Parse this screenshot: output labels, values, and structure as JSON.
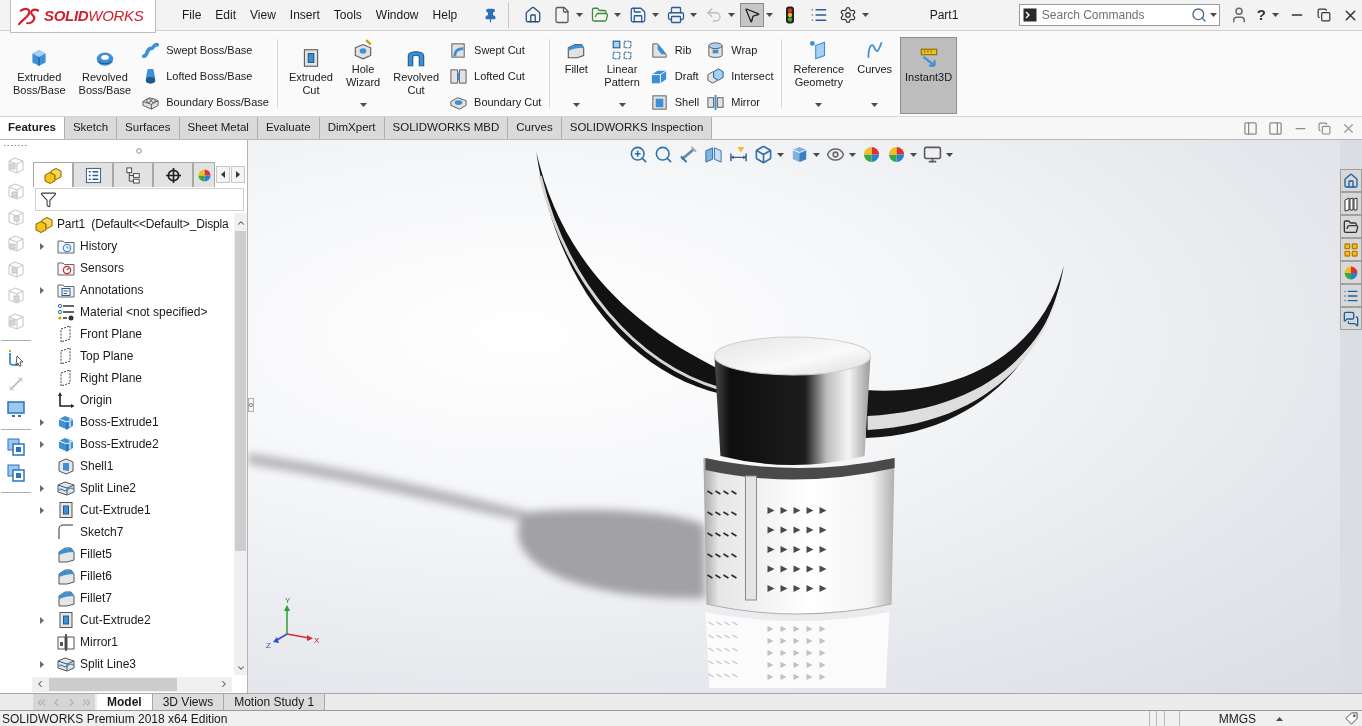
{
  "app": {
    "logo": "**SOLID**WORKS"
  },
  "menu": [
    "File",
    "Edit",
    "View",
    "Insert",
    "Tools",
    "Window",
    "Help"
  ],
  "quick_access": [
    {
      "dropdown": false,
      "pressed": false,
      "disabled": false
    },
    {
      "dropdown": true,
      "pressed": false,
      "disabled": false
    },
    {
      "dropdown": true,
      "pressed": false,
      "disabled": false
    },
    {
      "dropdown": true,
      "pressed": false,
      "disabled": false
    },
    {
      "dropdown": true,
      "pressed": false,
      "disabled": false
    },
    {
      "dropdown": true,
      "pressed": false,
      "disabled": true
    },
    {
      "dropdown": true,
      "pressed": true,
      "disabled": false
    },
    {
      "dropdown": false,
      "pressed": false,
      "disabled": false
    },
    {
      "dropdown": false,
      "pressed": false,
      "disabled": false
    },
    {
      "dropdown": true,
      "pressed": false,
      "disabled": false
    }
  ],
  "document_title": "Part1",
  "search": {
    "placeholder": "Search Commands"
  },
  "help": "?",
  "ribbon": {
    "groups": [
      {
        "items": [
          {
            "kind": "large",
            "label": "Extruded Boss/Base",
            "dropdown": false,
            "pressed": false
          },
          {
            "kind": "large",
            "label": "Revolved Boss/Base",
            "dropdown": false,
            "pressed": false
          },
          {
            "kind": "stack",
            "items": [
              "Swept Boss/Base",
              "Lofted Boss/Base",
              "Boundary Boss/Base"
            ]
          }
        ]
      },
      {
        "items": [
          {
            "kind": "large",
            "label": "Extruded Cut",
            "dropdown": false,
            "pressed": false
          },
          {
            "kind": "large",
            "label": "Hole Wizard",
            "dropdown": true,
            "pressed": false
          },
          {
            "kind": "large",
            "label": "Revolved Cut",
            "dropdown": false,
            "pressed": false
          },
          {
            "kind": "stack",
            "items": [
              "Swept Cut",
              "Lofted Cut",
              "Boundary Cut"
            ]
          }
        ]
      },
      {
        "items": [
          {
            "kind": "large",
            "label": "Fillet",
            "dropdown": true,
            "pressed": false
          },
          {
            "kind": "large",
            "label": "Linear Pattern",
            "dropdown": true,
            "pressed": false
          },
          {
            "kind": "stack",
            "items": [
              "Rib",
              "Draft",
              "Shell"
            ]
          },
          {
            "kind": "stack",
            "items": [
              "Wrap",
              "Intersect",
              "Mirror"
            ]
          }
        ]
      },
      {
        "items": [
          {
            "kind": "large",
            "label": "Reference Geometry",
            "dropdown": true,
            "pressed": false
          },
          {
            "kind": "large",
            "label": "Curves",
            "dropdown": true,
            "pressed": false
          },
          {
            "kind": "large",
            "label": "Instant3D",
            "dropdown": false,
            "pressed": true
          }
        ]
      }
    ]
  },
  "command_tabs": [
    {
      "label": "Features",
      "selected": true
    },
    {
      "label": "Sketch",
      "selected": false
    },
    {
      "label": "Surfaces",
      "selected": false
    },
    {
      "label": "Sheet Metal",
      "selected": false
    },
    {
      "label": "Evaluate",
      "selected": false
    },
    {
      "label": "DimXpert",
      "selected": false
    },
    {
      "label": "SOLIDWORKS MBD",
      "selected": false
    },
    {
      "label": "Curves",
      "selected": false
    },
    {
      "label": "SOLIDWORKS Inspection",
      "selected": false
    }
  ],
  "tool_groups": [
    [
      {
        "disabled": true
      },
      {
        "disabled": true
      },
      {
        "disabled": true
      },
      {
        "disabled": true
      },
      {
        "disabled": true
      },
      {
        "disabled": true
      },
      {
        "disabled": true
      }
    ],
    [
      {
        "disabled": false
      },
      {
        "disabled": true
      },
      {
        "disabled": false
      }
    ],
    [
      {
        "disabled": false
      },
      {
        "disabled": false
      }
    ]
  ],
  "feature_tabs": [
    {
      "selected": true
    },
    {
      "selected": false
    },
    {
      "selected": false
    },
    {
      "selected": false
    },
    {
      "selected": false
    }
  ],
  "feature_tree": {
    "label": "Part1  (Default<<Default>_Displa",
    "expander": false,
    "children": [
      {
        "label": "History",
        "expander": true
      },
      {
        "label": "Sensors",
        "expander": false
      },
      {
        "label": "Annotations",
        "expander": true
      },
      {
        "label": "Material <not specified>",
        "expander": false
      },
      {
        "label": "Front Plane",
        "expander": false
      },
      {
        "label": "Top Plane",
        "expander": false
      },
      {
        "label": "Right Plane",
        "expander": false
      },
      {
        "label": "Origin",
        "expander": false
      },
      {
        "label": "Boss-Extrude1",
        "expander": true
      },
      {
        "label": "Boss-Extrude2",
        "expander": true
      },
      {
        "label": "Shell1",
        "expander": false
      },
      {
        "label": "Split Line2",
        "expander": true
      },
      {
        "label": "Cut-Extrude1",
        "expander": true
      },
      {
        "label": "Sketch7",
        "expander": false
      },
      {
        "label": "Fillet5",
        "expander": false
      },
      {
        "label": "Fillet6",
        "expander": false
      },
      {
        "label": "Fillet7",
        "expander": false
      },
      {
        "label": "Cut-Extrude2",
        "expander": true
      },
      {
        "label": "Mirror1",
        "expander": false
      },
      {
        "label": "Split Line3",
        "expander": true
      }
    ]
  },
  "triad": [
    "Y",
    "X",
    "Z"
  ],
  "bottom_tabs": [
    {
      "label": "Model",
      "selected": true
    },
    {
      "label": "3D Views",
      "selected": false
    },
    {
      "label": "Motion Study 1",
      "selected": false
    }
  ],
  "status_bar": {
    "text": "SOLIDWORKS Premium 2018 x64 Edition",
    "units": "MMGS"
  }
}
